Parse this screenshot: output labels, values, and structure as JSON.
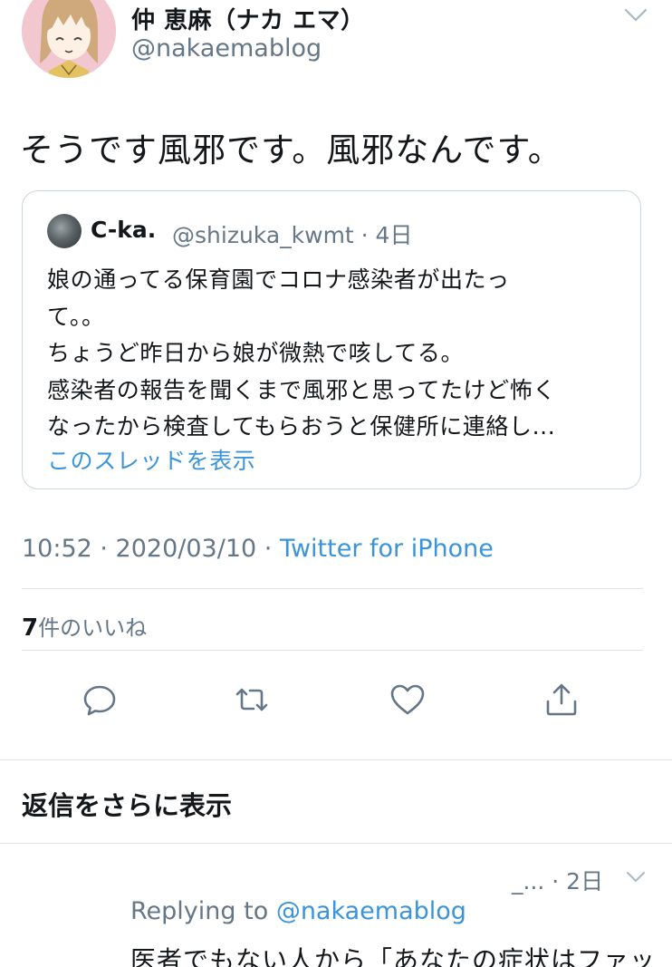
{
  "author": {
    "display_name": "仲 恵麻（ナカ エマ）",
    "handle": "@nakaemablog"
  },
  "tweet": {
    "text": "そうです風邪です。風邪なんです。",
    "timestamp": "10:52 · 2020/03/10 · ",
    "source": "Twitter for iPhone",
    "likes_count": "7",
    "likes_label": "件のいいね"
  },
  "quote": {
    "name": "C-ka.",
    "handle_time": "@shizuka_kwmt · 4日",
    "lines": [
      "娘の通ってる保育園でコロナ感染者が出たっ",
      "て。。",
      "ちょうど昨日から娘が微熱で咳してる。",
      "感染者の報告を聞くまで風邪と思ってたけど怖く",
      "なったから検査してもらおうと保健所に連絡し..."
    ],
    "show_thread": "このスレッドを表示"
  },
  "actions": [
    "reply-icon",
    "retweet-icon",
    "like-icon",
    "share-icon"
  ],
  "more_replies": "返信をさらに表示",
  "reply": {
    "meta": "_... · 2日",
    "replying_prefix": "Replying to ",
    "replying_to": "@nakaemablog",
    "text": "医者でもない人から「あなたの症状はファッ"
  },
  "colors": {
    "text": "#14171a",
    "secondary": "#657786",
    "link": "#3b94d9",
    "border": "#ccd6dd",
    "avatar_bg": "#f3c7cf"
  }
}
